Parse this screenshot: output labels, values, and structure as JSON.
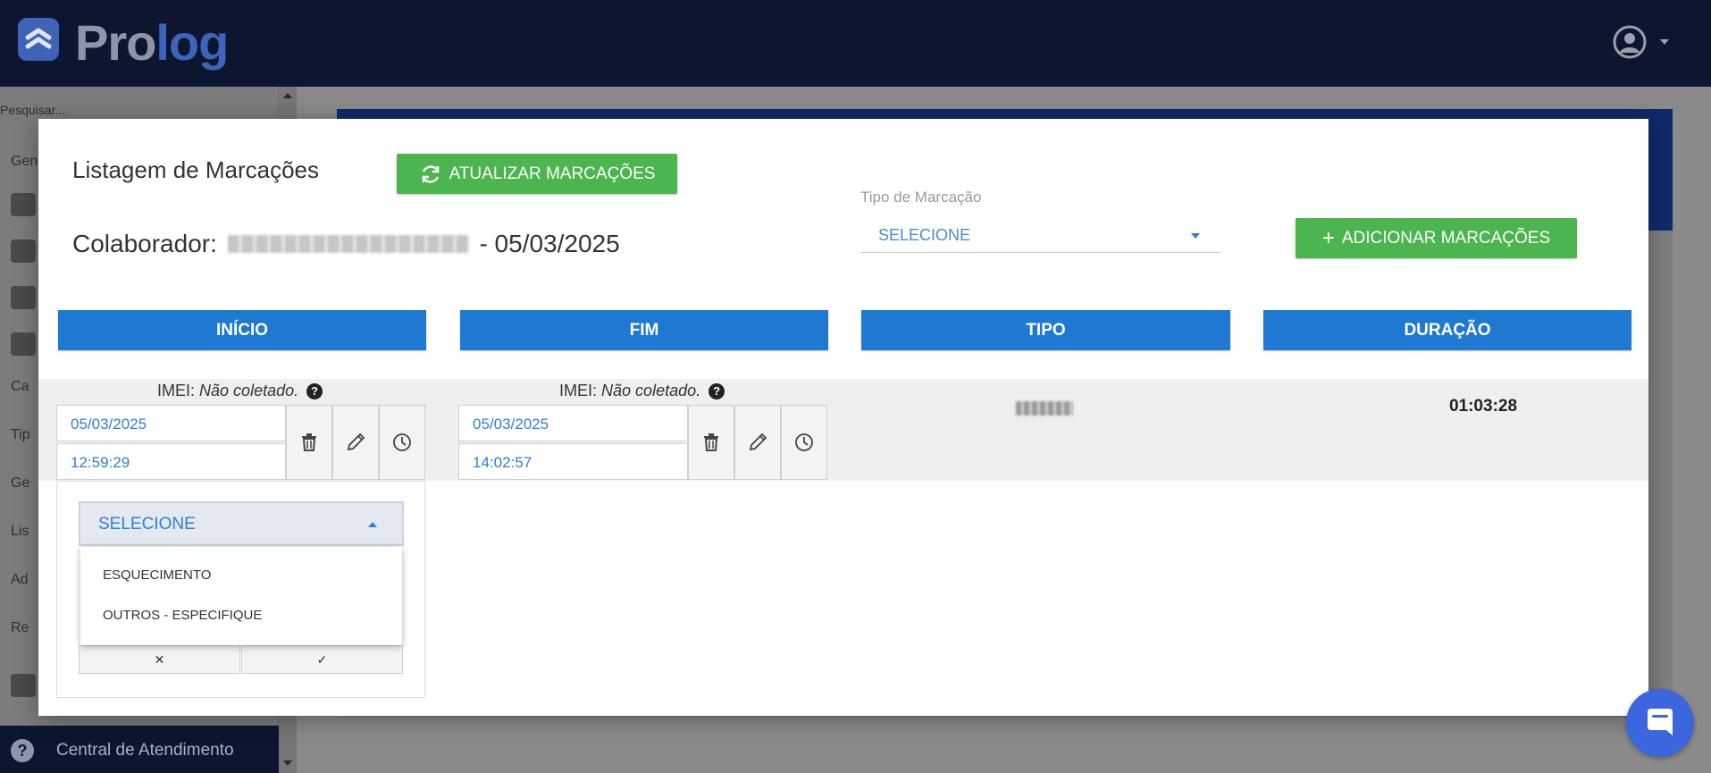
{
  "app": {
    "logo_part1": "Pro",
    "logo_part2": "log",
    "brand_color": "#3e63b8",
    "topbar_color": "#0d1630"
  },
  "sidebar": {
    "search_placeholder": "Pesquisar...",
    "fragments": [
      "Gen",
      "Ca",
      "Tip",
      "Ge",
      "Lis",
      "Ad",
      "Re"
    ],
    "help_label": "Central de Atendimento"
  },
  "modal": {
    "title": "Listagem de Marcações",
    "refresh_label": "ATUALIZAR MARCAÇÕES",
    "colaborador_label": "Colaborador:",
    "colaborador_date": "- 05/03/2025",
    "tipo_label": "Tipo de Marcação",
    "tipo_value": "SELECIONE",
    "add_label": "ADICIONAR MARCAÇÕES",
    "columns": [
      "INÍCIO",
      "FIM",
      "TIPO",
      "DURAÇÃO"
    ],
    "row": {
      "imei_label": "IMEI:",
      "imei_value": "Não coletado.",
      "start_date": "05/03/2025",
      "start_time": "12:59:29",
      "end_date": "05/03/2025",
      "end_time": "14:02:57",
      "duration": "01:03:28"
    },
    "justification": {
      "selected": "SELECIONE",
      "options": [
        "ESQUECIMENTO",
        "OUTROS - ESPECIFIQUE"
      ],
      "cancel_glyph": "✕",
      "confirm_glyph": "✓"
    },
    "accent_green": "#4cb54f",
    "accent_blue": "#1f78d1"
  },
  "icons": [
    "refresh-icon",
    "plus-icon",
    "trash-icon",
    "pencil-icon",
    "clock-icon",
    "user-icon",
    "help-icon",
    "chat-icon"
  ]
}
